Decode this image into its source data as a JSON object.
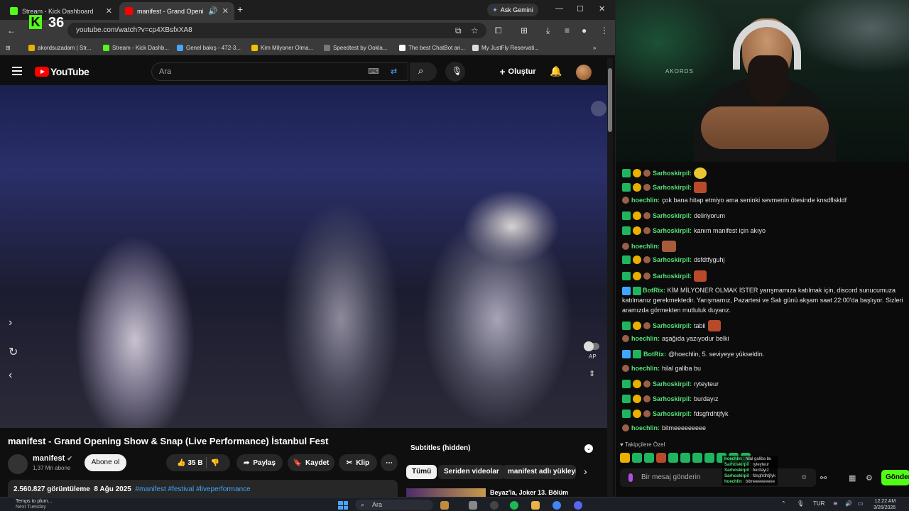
{
  "browser": {
    "tabs": [
      {
        "title": "Stream - Kick Dashboard",
        "favicon_color": "#53fc18"
      },
      {
        "title": "manifest - Grand Opening",
        "favicon_color": "#ff0000",
        "active": true
      }
    ],
    "ask_gemini": "Ask Gemini",
    "kick_count": "36",
    "url": "youtube.com/watch?v=cp4XBsfxXA8",
    "bookmarks": [
      {
        "label": "akordsuzadam | Str...",
        "color": "#e9b000"
      },
      {
        "label": "Stream - Kick Dashb...",
        "color": "#53fc18"
      },
      {
        "label": "Genel bakış - 472-3...",
        "color": "#4aa3ff"
      },
      {
        "label": "Kim Milyoner Olma...",
        "color": "#f3c300"
      },
      {
        "label": "Speedtest by Ookla...",
        "color": "#777777"
      },
      {
        "label": "The best ChatBot an...",
        "color": "#ffffff"
      },
      {
        "label": "My JustFly Reservati...",
        "color": "#dddddd"
      }
    ]
  },
  "youtube": {
    "logo_text": "YouTube",
    "search_placeholder": "Ara",
    "create_label": "Oluştur",
    "video_title": "manifest - Grand Opening Show & Snap (Live Performance) İstanbul Fest",
    "channel": {
      "name": "manifest",
      "subscribers": "1,37 Mn abone"
    },
    "subscribe_label": "Abone ol",
    "likes": "35 B",
    "share_label": "Paylaş",
    "save_label": "Kaydet",
    "clip_label": "Klip",
    "views": "2.560.827 görüntüleme",
    "date": "8 Ağu 2025",
    "hashtags": "#manifest #festival #liveperformance",
    "autoplay_label": "AP",
    "subtitles_label": "Subtitles (hidden)",
    "chips": [
      "Tümü",
      "Seriden videolar",
      "manifest adlı yükleyic"
    ],
    "rec_title": "Beyaz'la, Joker 13. Bölüm"
  },
  "stream": {
    "cam_label": "AKORDS",
    "messages": [
      {
        "user": "Sarhoskirpil:",
        "text": "",
        "emote": "yl",
        "badges": [
          "g",
          "y",
          "r"
        ]
      },
      {
        "user": "Sarhoskirpil:",
        "text": "",
        "emote": "r",
        "badges": [
          "g",
          "y",
          "r"
        ]
      },
      {
        "user": "hoechlin:",
        "text": "çok bana hitap etmiyo ama seninki sevmenin ötesinde knsdflskldf",
        "badges": [
          "r"
        ]
      },
      {
        "user": "Sarhoskirpil:",
        "text": "deliriyorum",
        "badges": [
          "g",
          "y",
          "r"
        ]
      },
      {
        "user": "Sarhoskirpil:",
        "text": "kanım manifest için akıyo",
        "badges": [
          "g",
          "y",
          "r"
        ]
      },
      {
        "user": "hoechlin:",
        "text": "",
        "emote": "bx",
        "badges": [
          "r"
        ]
      },
      {
        "user": "Sarhoskirpil:",
        "text": "dsfdtfyguhj",
        "badges": [
          "g",
          "y",
          "r"
        ]
      },
      {
        "user": "Sarhoskirpil:",
        "text": "",
        "emote": "r",
        "badges": [
          "g",
          "y",
          "r"
        ]
      },
      {
        "user": "BotRix:",
        "text": "KİM MİLYONER OLMAK İSTER yarışmamıza katılmak için, discord sunucumuza katılmanız gerekmektedir. Yarışmamız, Pazartesi ve Salı günü akşam saat 22:00'da başlıyor. Sizleri aramızda görmekten mutluluk duyarız.",
        "badges": [
          "v",
          "g"
        ],
        "multi": true
      },
      {
        "user": "Sarhoskirpil:",
        "text": "tabii",
        "emote": "r",
        "badges": [
          "g",
          "y",
          "r"
        ]
      },
      {
        "user": "hoechlin:",
        "text": "aşağıda yazıyodur belki",
        "badges": [
          "r"
        ]
      },
      {
        "user": "BotRix:",
        "text": "@hoechlin, 5. seviyeye yükseldin.",
        "badges": [
          "v",
          "g"
        ]
      },
      {
        "user": "hoechlin:",
        "text": "hilal galiba bu",
        "badges": [
          "r"
        ]
      },
      {
        "user": "Sarhoskirpil:",
        "text": "ryteyteur",
        "badges": [
          "g",
          "y",
          "r"
        ]
      },
      {
        "user": "Sarhoskirpil:",
        "text": "burdayız",
        "badges": [
          "g",
          "y",
          "r"
        ]
      },
      {
        "user": "Sarhoskirpil:",
        "text": "fdsgfrdhtjfyk",
        "badges": [
          "g",
          "y",
          "r"
        ]
      },
      {
        "user": "hoechlin:",
        "text": "bitmeeeeeeeee",
        "badges": [
          "r"
        ]
      }
    ],
    "fav_emotes_label": "Takipçilere Özel",
    "input_placeholder": "Bir mesaj gönderin",
    "send_label": "Gönder",
    "mini_chat": [
      {
        "user": "hoechlin",
        "text": "hilal galiba bu"
      },
      {
        "user": "Sarhoskirpil",
        "text": "ryteyteur"
      },
      {
        "user": "Sarhoskirpil",
        "text": "burdayız"
      },
      {
        "user": "Sarhoskirpil",
        "text": "fdsgfrdhtjfyk"
      },
      {
        "user": "hoechlin",
        "text": "bitmeeeeeeeee"
      }
    ]
  },
  "taskbar": {
    "weather_line1": "Temps to plum...",
    "weather_line2": "Next Tuesday",
    "search": "Ara",
    "lang": "TUR",
    "time": "12:22 AM",
    "date": "3/26/2026"
  }
}
